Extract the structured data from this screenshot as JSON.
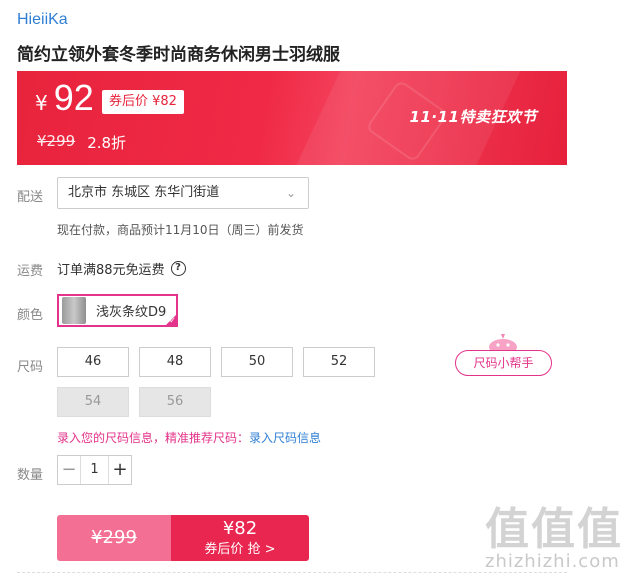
{
  "brand": "HieiiKa",
  "product_title": "简约立领外套冬季时尚商务休闲男士羽绒服",
  "price": {
    "currency": "¥",
    "current": "92",
    "coupon_tag": "券后价 ¥82",
    "original": "¥299",
    "discount": "2.8折",
    "festival": "11·11特卖狂欢节"
  },
  "delivery": {
    "label": "配送",
    "address": "北京市 东城区 东华门街道",
    "chevron_icon": "chevron-down-icon",
    "note": "现在付款，商品预计11月10日（周三）前发货"
  },
  "freight": {
    "label": "运费",
    "text": "订单满88元免运费",
    "help_icon": "question-icon",
    "help_glyph": "?"
  },
  "color": {
    "label": "颜色",
    "option": "浅灰条纹D9",
    "selected_color": "#e3338a"
  },
  "size": {
    "label": "尺码",
    "options": [
      "46",
      "48",
      "50",
      "52",
      "54",
      "56"
    ],
    "disabled": [
      "54",
      "56"
    ],
    "helper": "尺码小帮手",
    "info_prefix": "录入您的尺码信息，精准推荐尺码：",
    "info_link": "录入尺码信息"
  },
  "quantity": {
    "label": "数量",
    "minus": "−",
    "value": "1",
    "plus": "+"
  },
  "buy": {
    "original": "¥299",
    "coupon_price": "¥82",
    "coupon_label": "券后价 抢 >"
  },
  "watermark": {
    "big": "值值值",
    "small": "zhizhizhi.com"
  },
  "colors": {
    "accent": "#e3338a",
    "banner": "#e8233c",
    "link": "#2f7fd3"
  }
}
